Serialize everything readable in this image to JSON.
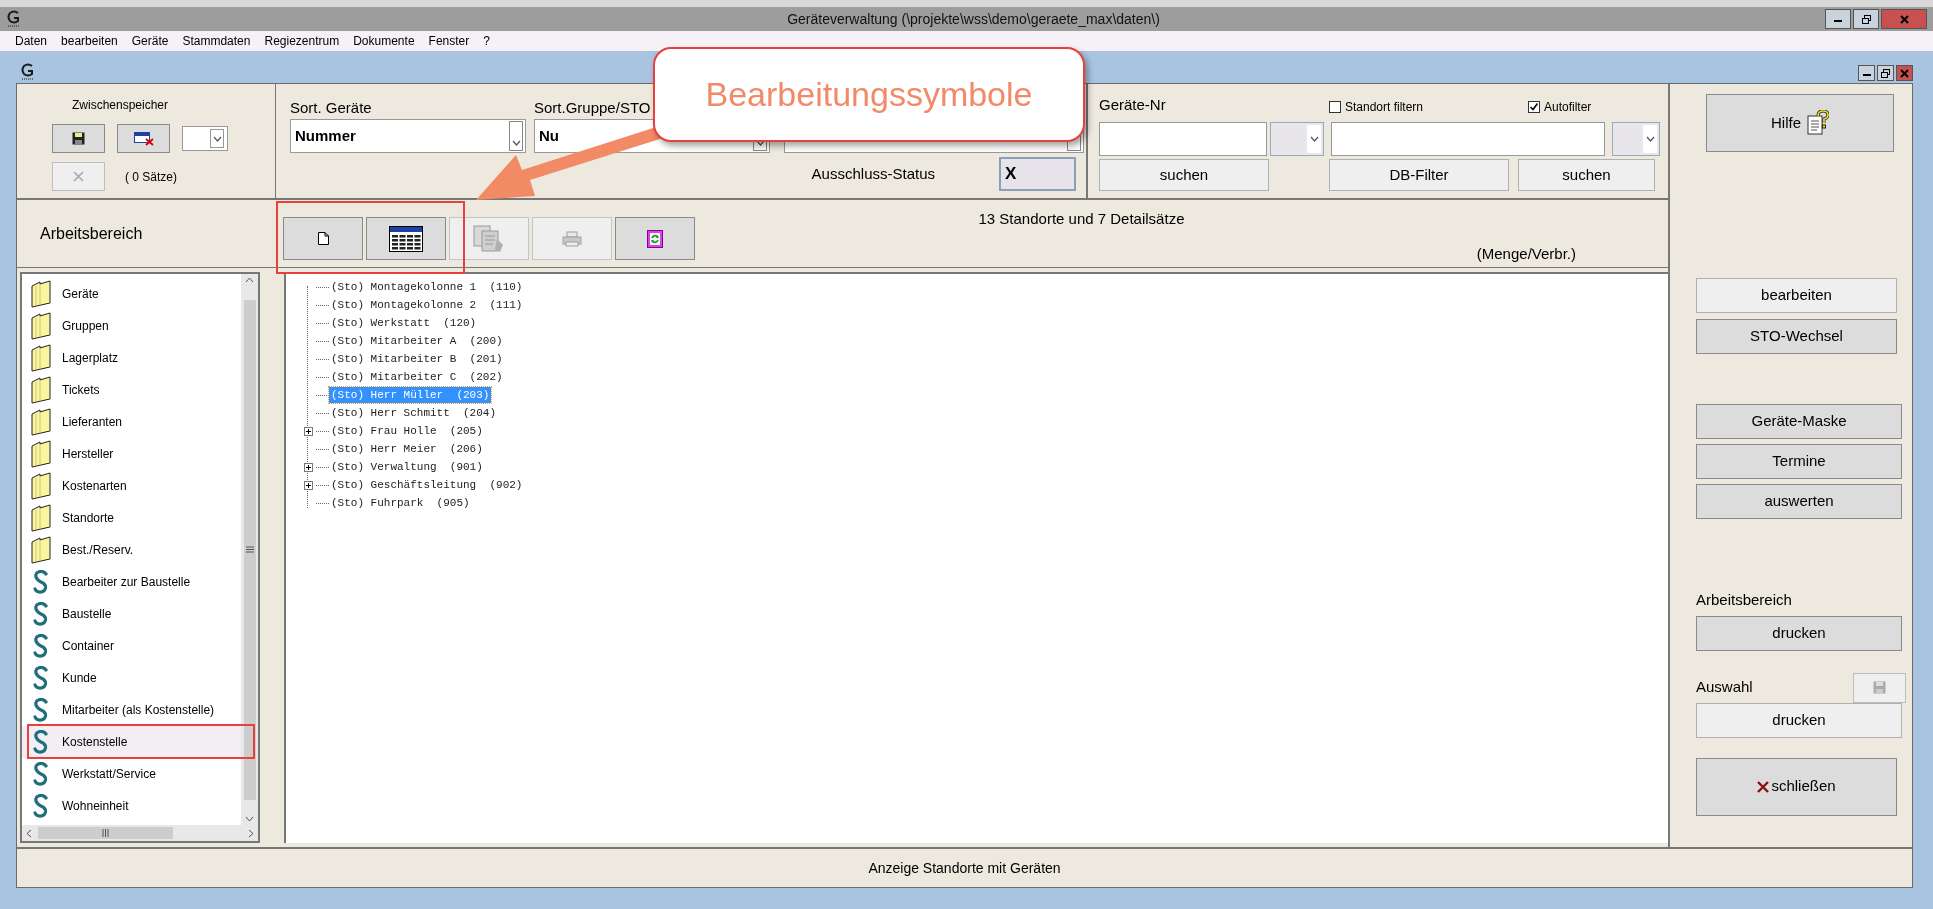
{
  "window": {
    "title": "Geräteverwaltung (\\projekte\\wss\\demo\\geraete_max\\daten\\)"
  },
  "menu": [
    "Daten",
    "bearbeiten",
    "Geräte",
    "Stammdaten",
    "Regiezentrum",
    "Dokumente",
    "Fenster",
    "?"
  ],
  "clipboard": {
    "label": "Zwischenspeicher",
    "count": "( 0 Sätze)"
  },
  "sort": [
    {
      "label": "Sort. Geräte",
      "value": "Nummer"
    },
    {
      "label": "Sort.Gruppe/STO",
      "value": "Nu"
    }
  ],
  "exclusion": {
    "label": "Ausschluss-Status",
    "value": "X"
  },
  "search": {
    "label": "Geräte-Nr",
    "filters": [
      {
        "label": "Standort filtern",
        "checked": false
      },
      {
        "label": "Autofilter",
        "checked": true
      }
    ],
    "buttons": [
      "suchen",
      "DB-Filter",
      "suchen"
    ]
  },
  "workspace": {
    "label": "Arbeitsbereich",
    "summary": "13 Standorte und 7 Detailsätze",
    "unit": "(Menge/Verbr.)",
    "tools": [
      {
        "kind": "new",
        "disabled": false
      },
      {
        "kind": "table",
        "disabled": false
      },
      {
        "kind": "copy",
        "disabled": true
      },
      {
        "kind": "print",
        "disabled": true
      },
      {
        "kind": "refresh",
        "disabled": false
      }
    ]
  },
  "sidebar": {
    "items": [
      {
        "kind": "folder",
        "label": "Geräte",
        "selected": false
      },
      {
        "kind": "folder",
        "label": "Gruppen",
        "selected": false
      },
      {
        "kind": "folder",
        "label": "Lagerplatz",
        "selected": false
      },
      {
        "kind": "folder",
        "label": "Tickets",
        "selected": false
      },
      {
        "kind": "folder",
        "label": "Lieferanten",
        "selected": false
      },
      {
        "kind": "folder",
        "label": "Hersteller",
        "selected": false
      },
      {
        "kind": "folder",
        "label": "Kostenarten",
        "selected": false
      },
      {
        "kind": "folder",
        "label": "Standorte",
        "selected": false
      },
      {
        "kind": "folder",
        "label": "Best./Reserv.",
        "selected": false
      },
      {
        "kind": "s",
        "label": "Bearbeiter zur Baustelle",
        "selected": false
      },
      {
        "kind": "s",
        "label": "Baustelle",
        "selected": false
      },
      {
        "kind": "s",
        "label": "Container",
        "selected": false
      },
      {
        "kind": "s",
        "label": "Kunde",
        "selected": false
      },
      {
        "kind": "s",
        "label": "Mitarbeiter (als Kostenstelle)",
        "selected": false
      },
      {
        "kind": "s",
        "label": "Kostenstelle",
        "selected": true
      },
      {
        "kind": "s",
        "label": "Werkstatt/Service",
        "selected": false
      },
      {
        "kind": "s",
        "label": "Wohneinheit",
        "selected": false
      }
    ]
  },
  "tree": {
    "items": [
      {
        "text": "(Sto) Montagekolonne 1  (110)",
        "expandable": false,
        "selected": false
      },
      {
        "text": "(Sto) Montagekolonne 2  (111)",
        "expandable": false,
        "selected": false
      },
      {
        "text": "(Sto) Werkstatt  (120)",
        "expandable": false,
        "selected": false
      },
      {
        "text": "(Sto) Mitarbeiter A  (200)",
        "expandable": false,
        "selected": false
      },
      {
        "text": "(Sto) Mitarbeiter B  (201)",
        "expandable": false,
        "selected": false
      },
      {
        "text": "(Sto) Mitarbeiter C  (202)",
        "expandable": false,
        "selected": false
      },
      {
        "text": "(Sto) Herr Müller  (203)",
        "expandable": false,
        "selected": true
      },
      {
        "text": "(Sto) Herr Schmitt  (204)",
        "expandable": false,
        "selected": false
      },
      {
        "text": "(Sto) Frau Holle  (205)",
        "expandable": true,
        "selected": false
      },
      {
        "text": "(Sto) Herr Meier  (206)",
        "expandable": false,
        "selected": false
      },
      {
        "text": "(Sto) Verwaltung  (901)",
        "expandable": true,
        "selected": false
      },
      {
        "text": "(Sto) Geschäftsleitung  (902)",
        "expandable": true,
        "selected": false
      },
      {
        "text": "(Sto) Fuhrpark  (905)",
        "expandable": false,
        "selected": false
      }
    ]
  },
  "actions": {
    "help": "Hilfe",
    "edit_buttons": [
      "bearbeiten",
      "STO-Wechsel"
    ],
    "view_buttons": [
      "Geräte-Maske",
      "Termine",
      "auswerten"
    ],
    "print_workspace": {
      "label": "Arbeitsbereich",
      "button": "drucken"
    },
    "print_selection": {
      "label": "Auswahl",
      "button": "drucken"
    },
    "close": "schließen"
  },
  "status_bar": "Anzeige Standorte mit Geräten",
  "annotation": {
    "callout": "Bearbeitungssymbole"
  }
}
